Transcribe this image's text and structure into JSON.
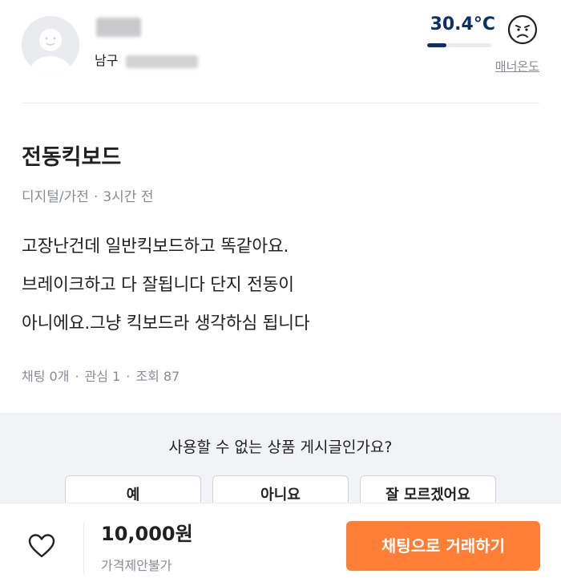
{
  "seller": {
    "region": "남구",
    "manner_temperature": "30.4°C",
    "manner_temperature_level": 0.304,
    "manner_label": "매너온도",
    "face_icon": "frown-face-icon",
    "avatar_icon": "default-avatar-icon"
  },
  "listing": {
    "title": "전동킥보드",
    "category": "디지털/가전",
    "time_ago": "3시간 전",
    "meta_separator": "·",
    "description_lines": [
      "고장난건데 일반킥보드하고 똑같아요.",
      "브레이크하고 다 잘됩니다 단지 전동이",
      "아니에요.그냥 킥보드라 생각하심 됩니다"
    ],
    "stats": {
      "chats": "채팅 0개",
      "interests": "관심 1",
      "views": "조회 87"
    }
  },
  "report": {
    "question": "사용할 수 없는 상품 게시글인가요?",
    "options": [
      "예",
      "아니요",
      "잘 모르겠어요"
    ]
  },
  "bottom_bar": {
    "price": "10,000원",
    "price_note": "가격제안불가",
    "chat_button_label": "채팅으로 거래하기",
    "heart_icon": "heart-outline-icon"
  },
  "colors": {
    "accent_orange": "#ff7e36",
    "temperature_navy": "#0b2f6a",
    "muted_text": "#868b94",
    "panel_gray": "#f2f3f6"
  }
}
